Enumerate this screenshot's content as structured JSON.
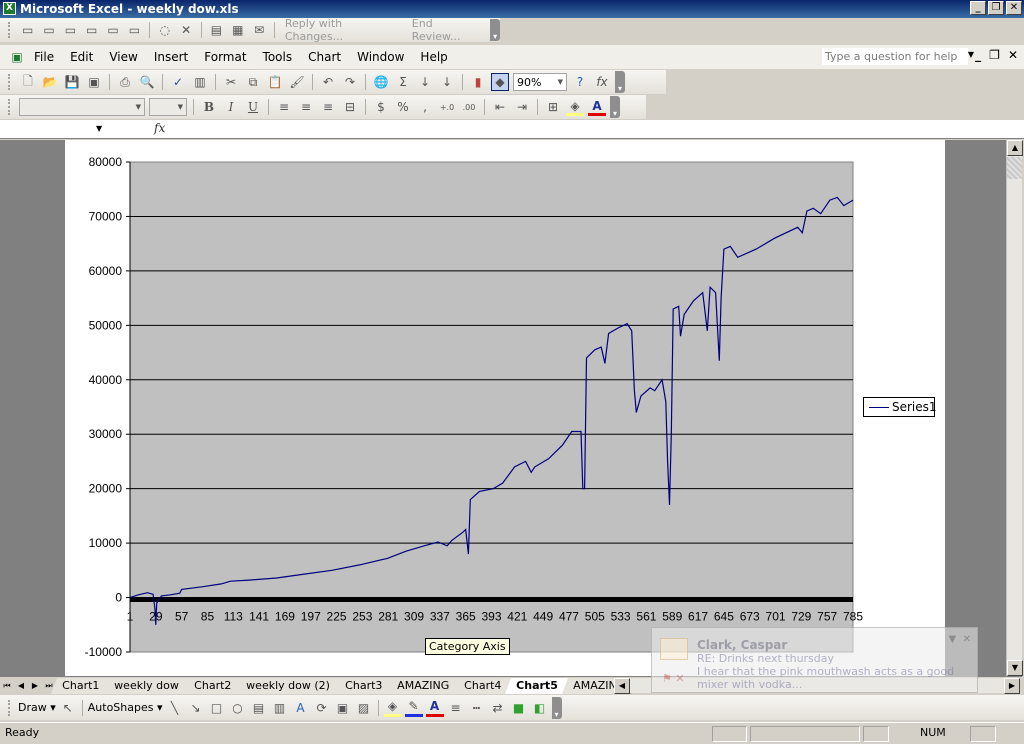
{
  "window": {
    "title": "Microsoft Excel - weekly dow.xls",
    "app_icon": "excel-icon"
  },
  "reviewing_toolbar": {
    "reply_label": "Reply with Changes...",
    "end_review_label": "End Review..."
  },
  "menu": {
    "items": [
      "File",
      "Edit",
      "View",
      "Insert",
      "Format",
      "Tools",
      "Chart",
      "Window",
      "Help"
    ]
  },
  "help": {
    "placeholder": "Type a question for help"
  },
  "standard_toolbar": {
    "zoom_value": "90%"
  },
  "formatting_toolbar": {
    "font": "",
    "size": ""
  },
  "formula_bar": {
    "name_box": "",
    "fx_label": "fx"
  },
  "chart_data": {
    "type": "line",
    "title": "",
    "xlabel": "",
    "ylabel": "",
    "ylim": [
      -10000,
      80000
    ],
    "yticks": [
      80000,
      70000,
      60000,
      50000,
      40000,
      30000,
      20000,
      10000,
      0,
      -10000
    ],
    "ytick_labels": [
      "80000",
      "70000",
      "60000",
      "50000",
      "40000",
      "30000",
      "20000",
      "10000",
      "0",
      "-10000"
    ],
    "xtick_labels": [
      "1",
      "29",
      "57",
      "85",
      "113",
      "141",
      "169",
      "197",
      "225",
      "253",
      "281",
      "309",
      "337",
      "365",
      "393",
      "421",
      "449",
      "477",
      "505",
      "533",
      "561",
      "589",
      "617",
      "645",
      "673",
      "701",
      "729",
      "757",
      "785"
    ],
    "xlim": [
      1,
      785
    ],
    "grid": "horizontal-major",
    "plot_bg": "#c0c0c0",
    "line_color": "#000080",
    "legend": {
      "position": "right",
      "entries": [
        "Series1"
      ]
    },
    "series": [
      {
        "name": "Series1",
        "points": [
          [
            1,
            0
          ],
          [
            10,
            500
          ],
          [
            20,
            900
          ],
          [
            26,
            600
          ],
          [
            28,
            -2000
          ],
          [
            29,
            -5000
          ],
          [
            30,
            -1000
          ],
          [
            35,
            300
          ],
          [
            45,
            500
          ],
          [
            55,
            800
          ],
          [
            57,
            1500
          ],
          [
            80,
            2000
          ],
          [
            100,
            2500
          ],
          [
            110,
            3000
          ],
          [
            130,
            3200
          ],
          [
            160,
            3600
          ],
          [
            190,
            4300
          ],
          [
            220,
            5000
          ],
          [
            250,
            6000
          ],
          [
            280,
            7200
          ],
          [
            300,
            8500
          ],
          [
            320,
            9500
          ],
          [
            335,
            10200
          ],
          [
            345,
            9500
          ],
          [
            350,
            10500
          ],
          [
            362,
            12000
          ],
          [
            365,
            12500
          ],
          [
            368,
            8000
          ],
          [
            370,
            18000
          ],
          [
            380,
            19500
          ],
          [
            395,
            20000
          ],
          [
            405,
            21000
          ],
          [
            418,
            24000
          ],
          [
            430,
            25000
          ],
          [
            436,
            23000
          ],
          [
            440,
            24000
          ],
          [
            455,
            25500
          ],
          [
            470,
            28000
          ],
          [
            480,
            30500
          ],
          [
            490,
            30500
          ],
          [
            492,
            20000
          ],
          [
            494,
            20000
          ],
          [
            496,
            44000
          ],
          [
            505,
            45500
          ],
          [
            512,
            46000
          ],
          [
            516,
            43000
          ],
          [
            520,
            48500
          ],
          [
            530,
            49500
          ],
          [
            540,
            50300
          ],
          [
            545,
            49000
          ],
          [
            548,
            38000
          ],
          [
            550,
            34000
          ],
          [
            555,
            37000
          ],
          [
            565,
            38500
          ],
          [
            570,
            38000
          ],
          [
            578,
            40000
          ],
          [
            582,
            36000
          ],
          [
            584,
            25000
          ],
          [
            586,
            17000
          ],
          [
            588,
            30000
          ],
          [
            590,
            53000
          ],
          [
            596,
            53500
          ],
          [
            598,
            48000
          ],
          [
            602,
            52000
          ],
          [
            612,
            54500
          ],
          [
            622,
            56000
          ],
          [
            627,
            49000
          ],
          [
            630,
            57000
          ],
          [
            636,
            56000
          ],
          [
            640,
            43500
          ],
          [
            642,
            55000
          ],
          [
            645,
            64000
          ],
          [
            652,
            64500
          ],
          [
            660,
            62500
          ],
          [
            680,
            64000
          ],
          [
            700,
            66000
          ],
          [
            725,
            68000
          ],
          [
            730,
            67000
          ],
          [
            735,
            71000
          ],
          [
            742,
            71500
          ],
          [
            750,
            70500
          ],
          [
            760,
            73000
          ],
          [
            768,
            73500
          ],
          [
            775,
            72000
          ],
          [
            785,
            73000
          ]
        ]
      }
    ]
  },
  "tooltip": {
    "text": "Category Axis"
  },
  "sheet_tabs": {
    "tabs": [
      "Chart1",
      "weekly dow",
      "Chart2",
      "weekly dow (2)",
      "Chart3",
      "AMAZING",
      "Chart4",
      "Chart5",
      "AMAZING"
    ],
    "active_index": 7
  },
  "draw_toolbar": {
    "draw_label": "Draw",
    "autoshapes_label": "AutoShapes"
  },
  "status_bar": {
    "status": "Ready",
    "num": "NUM"
  },
  "notification": {
    "from": "Clark, Caspar",
    "subject": "RE: Drinks next thursday",
    "body": "I hear that the pink mouthwash acts as a good mixer with vodka..."
  }
}
